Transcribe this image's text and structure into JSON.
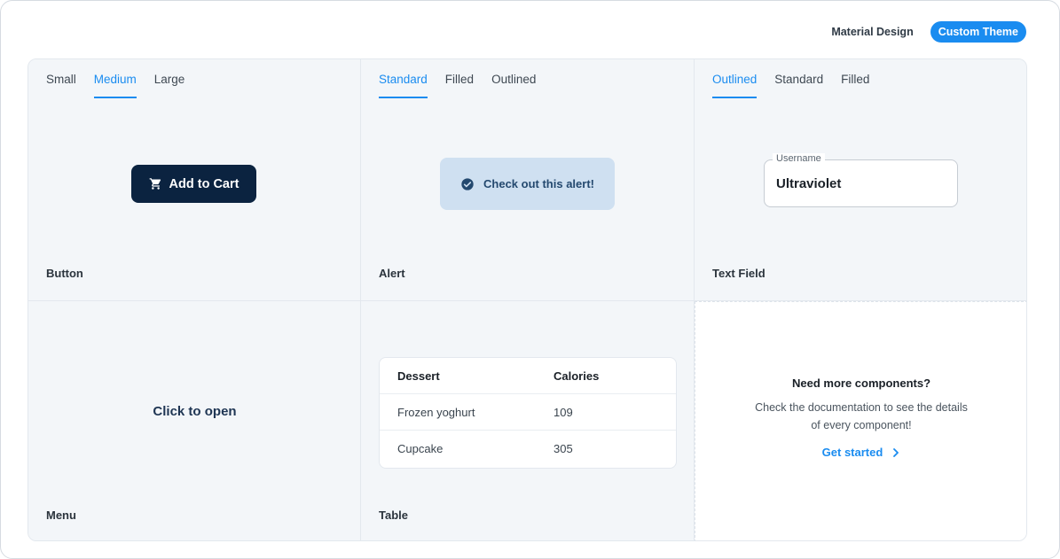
{
  "theme_switch": {
    "options": [
      "Material Design",
      "Custom Theme"
    ],
    "active": "Custom Theme"
  },
  "button_demo": {
    "tabs": [
      "Small",
      "Medium",
      "Large"
    ],
    "active_tab": "Medium",
    "button_label": "Add to Cart",
    "button_icon": "shopping-cart-icon",
    "label": "Button"
  },
  "alert_demo": {
    "tabs": [
      "Standard",
      "Filled",
      "Outlined"
    ],
    "active_tab": "Standard",
    "message": "Check out this alert!",
    "icon": "check-circle-icon",
    "label": "Alert"
  },
  "textfield_demo": {
    "tabs": [
      "Outlined",
      "Standard",
      "Filled"
    ],
    "active_tab": "Outlined",
    "field_label": "Username",
    "field_value": "Ultraviolet",
    "label": "Text Field"
  },
  "menu_demo": {
    "trigger": "Click to open",
    "label": "Menu"
  },
  "table_demo": {
    "columns": [
      "Dessert",
      "Calories"
    ],
    "rows": [
      [
        "Frozen yoghurt",
        "109"
      ],
      [
        "Cupcake",
        "305"
      ]
    ],
    "label": "Table"
  },
  "cta": {
    "title": "Need more components?",
    "description": "Check the documentation to see the details of every component!",
    "link": "Get started",
    "link_icon": "chevron-right-icon"
  },
  "colors": {
    "accent": "#1a8cf0",
    "button_bg": "#0b2340",
    "alert_bg": "#cfe0f1",
    "panel_bg": "#f3f6f9"
  }
}
